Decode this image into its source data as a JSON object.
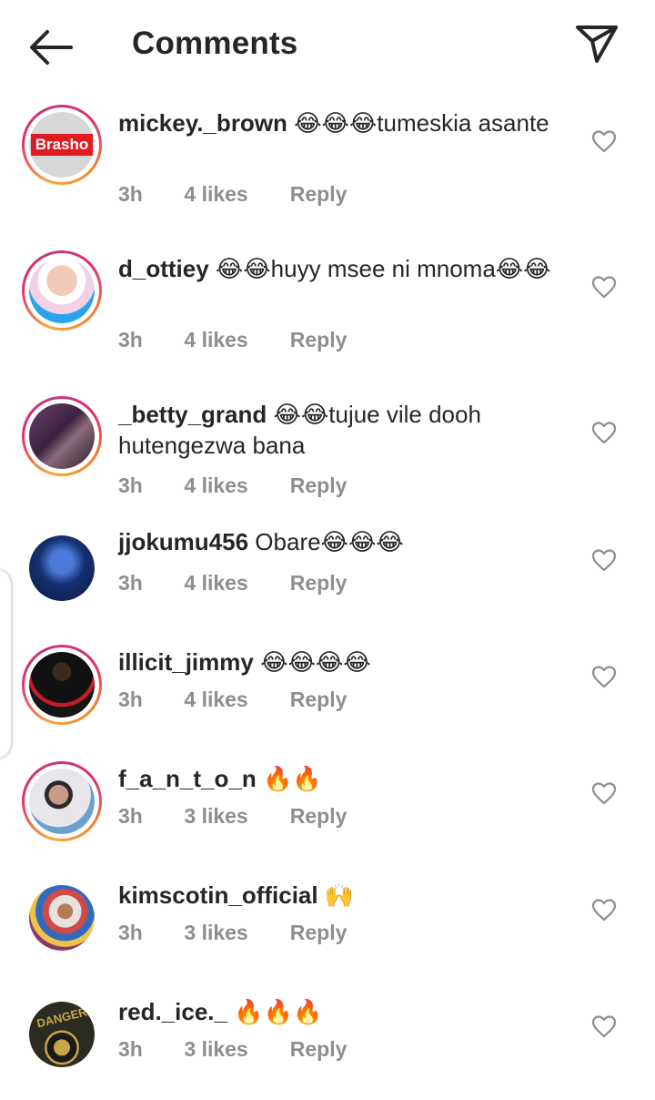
{
  "header": {
    "title": "Comments"
  },
  "icons": {
    "back": "arrow-left-icon",
    "send": "paper-plane-icon",
    "like": "heart-outline-icon"
  },
  "avatars": {
    "brasho_label": "Brasho",
    "danger_label": "DANGER"
  },
  "comments": [
    {
      "username": "mickey._brown",
      "text": "😂😂😂tumeskia asante",
      "time": "3h",
      "likes": "4 likes",
      "reply": "Reply"
    },
    {
      "username": "d_ottiey",
      "text": "😂😂huyy msee ni mnoma😂😂",
      "time": "3h",
      "likes": "4 likes",
      "reply": "Reply"
    },
    {
      "username": "_betty_grand",
      "text": "😂😂tujue vile dooh hutengezwa bana",
      "time": "3h",
      "likes": "4 likes",
      "reply": "Reply"
    },
    {
      "username": "jjokumu456",
      "text": "Obare😂😂😂",
      "time": "3h",
      "likes": "4 likes",
      "reply": "Reply"
    },
    {
      "username": "illicit_jimmy",
      "text": "😂😂😂😂",
      "time": "3h",
      "likes": "4 likes",
      "reply": "Reply"
    },
    {
      "username": "f_a_n_t_o_n",
      "text": "🔥🔥",
      "time": "3h",
      "likes": "3 likes",
      "reply": "Reply"
    },
    {
      "username": "kimscotin_official",
      "text": "🙌",
      "time": "3h",
      "likes": "3 likes",
      "reply": "Reply"
    },
    {
      "username": "red._ice._",
      "text": "🔥🔥🔥",
      "time": "3h",
      "likes": "3 likes",
      "reply": "Reply"
    }
  ]
}
